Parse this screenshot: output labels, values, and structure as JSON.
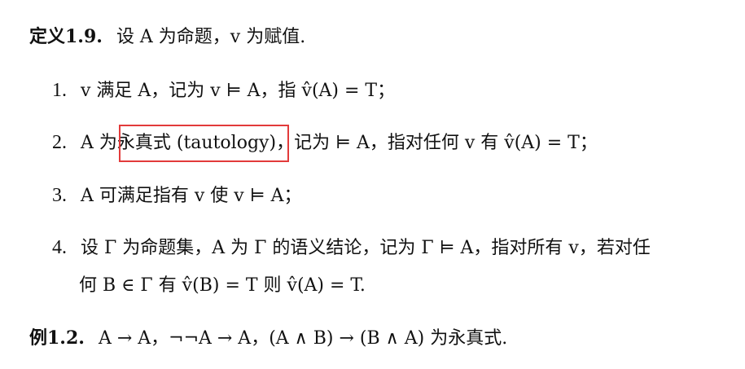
{
  "definition": {
    "heading": "定义1.9.",
    "text": "设 A 为命题，v 为赋值."
  },
  "items": [
    {
      "number": "1.",
      "text": "v 满足 A，记为 v ⊨ A，指 v̂(A) = T；"
    },
    {
      "number": "2.",
      "before": "A 为",
      "highlighted": "永真式 (tautology)",
      "after": "，记为 ⊨ A，指对任何 v 有 v̂(A) = T；"
    },
    {
      "number": "3.",
      "text": "A 可满足指有 v 使 v ⊨ A；"
    },
    {
      "number": "4.",
      "text": "设 Γ 为命题集，A 为 Γ 的语义结论，记为 Γ ⊨ A，指对所有 v，若对任",
      "continuation": "何 B ∈ Γ 有 v̂(B) = T 则 v̂(A) = T."
    }
  ],
  "example": {
    "heading": "例1.2.",
    "text": "A → A，¬¬A → A，(A ∧ B) → (B ∧ A) 为永真式."
  },
  "highlight_color": "#e23b3b"
}
